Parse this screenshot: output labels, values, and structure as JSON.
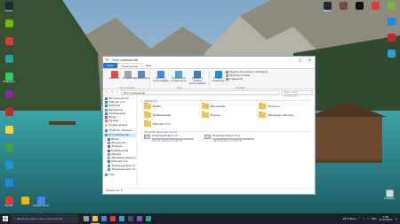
{
  "colors": {
    "accent": "#1979ca",
    "folder": "#f2c44f",
    "drive_c_used": "#d9242d",
    "drive_d_used": "#26a0da",
    "taskbar": "#1c2129"
  },
  "desktop_left": [
    {
      "label": "Steam",
      "icon": "steam-icon",
      "color": "#1b2838"
    },
    {
      "label": "",
      "icon": "nvidia-icon",
      "color": "#76b900"
    },
    {
      "label": "",
      "icon": "app-icon",
      "color": "#e53935"
    },
    {
      "label": "",
      "icon": "app-icon",
      "color": "#26a69a"
    },
    {
      "label": "WhatsApp",
      "icon": "whatsapp-icon",
      "color": "#25d366"
    },
    {
      "label": "",
      "icon": "app-icon",
      "color": "#8e24aa"
    },
    {
      "label": "",
      "icon": "app-icon",
      "color": "#c62828"
    },
    {
      "label": "",
      "icon": "app-icon",
      "color": "#fdd835"
    },
    {
      "label": "",
      "icon": "app-icon",
      "color": "#43a047"
    },
    {
      "label": "",
      "icon": "edge-icon",
      "color": "#0f9bd7"
    },
    {
      "label": "",
      "icon": "app-icon",
      "color": "#1e88e5"
    }
  ],
  "desktop_right": [
    {
      "label": "Steam",
      "icon": "steam-icon",
      "color": "#1b2838"
    },
    {
      "label": "",
      "icon": "app-icon",
      "color": "#6d4c41"
    },
    {
      "label": "",
      "icon": "app-icon",
      "color": "#111111"
    },
    {
      "label": "",
      "icon": "app-icon",
      "color": "#e53935"
    },
    {
      "label": "",
      "icon": "app-icon",
      "color": "#7cb342"
    },
    {
      "label": "",
      "icon": "chrome-icon",
      "color": "#1e88e5"
    },
    {
      "label": "",
      "icon": "app-icon",
      "color": "#c62828"
    },
    {
      "label": "",
      "icon": "telegram-icon",
      "color": "#2aa1da"
    }
  ],
  "desktop_bottom": [
    {
      "label": "Yandex",
      "icon": "yandex-icon",
      "color": "#e53935"
    },
    {
      "label": "",
      "icon": "app-icon",
      "color": "#ffb300"
    },
    {
      "label": "Google Chrome",
      "icon": "chrome-icon",
      "color": "#4285f4"
    }
  ],
  "recycle_bin": {
    "label": "Корзина",
    "icon": "recycle-bin-icon"
  },
  "window": {
    "title": "Этот компьютер",
    "tabs": [
      "Файл",
      "Компьютер",
      "Вид"
    ],
    "ribbon": {
      "groups": [
        {
          "name": "Расположение",
          "buttons": [
            "Свойства",
            "Открыть",
            "Переименовать"
          ]
        },
        {
          "name": "Сеть",
          "buttons": [
            "Доступ к мультимедиа",
            "Подключить сетевой диск",
            "Добавить сетевое расположение"
          ]
        },
        {
          "name": "Система",
          "buttons": [
            "Открыть параметры"
          ]
        }
      ],
      "system_small": [
        "Удалить или изменить программу",
        "Свойства системы",
        "Управление"
      ]
    },
    "address": "Этот компьютер",
    "search_placeholder": "Поиск: Этот компьютер",
    "nav": [
      {
        "label": "Быстрый доступ",
        "icon": "star-icon",
        "color": "#2b7bd6"
      },
      {
        "label": "Рабочий стол",
        "icon": "desktop-icon",
        "color": "#2b7bd6"
      },
      {
        "label": "Загрузки",
        "icon": "download-icon",
        "color": "#2b7bd6"
      },
      {
        "label": "Документы",
        "icon": "document-icon",
        "color": "#8a8f96"
      },
      {
        "label": "Изображения",
        "icon": "image-icon",
        "color": "#2b7bd6"
      },
      {
        "label": "Видео",
        "icon": "video-icon",
        "color": "#5c6bc0"
      },
      {
        "label": "Музыка",
        "icon": "music-icon",
        "color": "#e57373"
      },
      {
        "label": "Снимки экрана",
        "icon": "folder-icon",
        "color": "#f2c44f"
      },
      {
        "label": "OneDrive - Personal",
        "icon": "onedrive-icon",
        "color": "#1e88e5"
      },
      {
        "label": "Этот компьютер",
        "icon": "computer-icon",
        "color": "#4a90d9",
        "selected": true
      },
      {
        "label": "Видео",
        "icon": "video-icon",
        "color": "#5c6bc0"
      },
      {
        "label": "Документы",
        "icon": "document-icon",
        "color": "#8a8f96"
      },
      {
        "label": "Загрузки",
        "icon": "download-icon",
        "color": "#2b7bd6"
      },
      {
        "label": "Изображения",
        "icon": "image-icon",
        "color": "#2b7bd6"
      },
      {
        "label": "Музыка",
        "icon": "music-icon",
        "color": "#e57373"
      },
      {
        "label": "Объемные объекты",
        "icon": "3d-icon",
        "color": "#4fc3f7"
      },
      {
        "label": "Рабочий стол",
        "icon": "desktop-icon",
        "color": "#2b7bd6"
      },
      {
        "label": "Локальный диск (C:)",
        "icon": "drive-icon",
        "color": "#78909c"
      },
      {
        "label": "Локальный диск (D:)",
        "icon": "drive-icon",
        "color": "#78909c"
      },
      {
        "label": "Сеть",
        "icon": "network-icon",
        "color": "#4a90d9"
      }
    ],
    "folders_header": "Папки (7)",
    "folders": [
      "Видео",
      "Документы",
      "Загрузки",
      "Изображения",
      "Музыка",
      "Объемные объекты",
      "Рабочий стол"
    ],
    "drives_header": "Устройства и диски (2)",
    "drives": [
      {
        "name": "Локальный диск (C:)",
        "free": "6,63 ГБ свободно из 222 ГБ",
        "used_fraction": 0.97
      },
      {
        "name": "Локальный диск (D:)",
        "free": "712 ГБ свободно из 931 ГБ",
        "used_fraction": 0.24
      }
    ],
    "status": "Элементов: 9"
  },
  "taskbar": {
    "search_placeholder": "Введите здесь текст для поиска",
    "apps": [
      {
        "name": "task-view-icon",
        "color": "#9e9e9e"
      },
      {
        "name": "explorer-icon",
        "color": "#f2c44f",
        "active": true
      },
      {
        "name": "chrome-icon",
        "color": "#4285f4"
      },
      {
        "name": "yandex-icon",
        "color": "#e53935"
      },
      {
        "name": "telegram-icon",
        "color": "#2aa1da"
      },
      {
        "name": "steam-icon",
        "color": "#3b4f66"
      },
      {
        "name": "app-icon",
        "color": "#7e57c2"
      },
      {
        "name": "app-icon",
        "color": "#26a69a"
      }
    ],
    "weather": "16°C Ясно",
    "lang": "РУС",
    "time": "1:38",
    "date": "27.10.2022"
  }
}
